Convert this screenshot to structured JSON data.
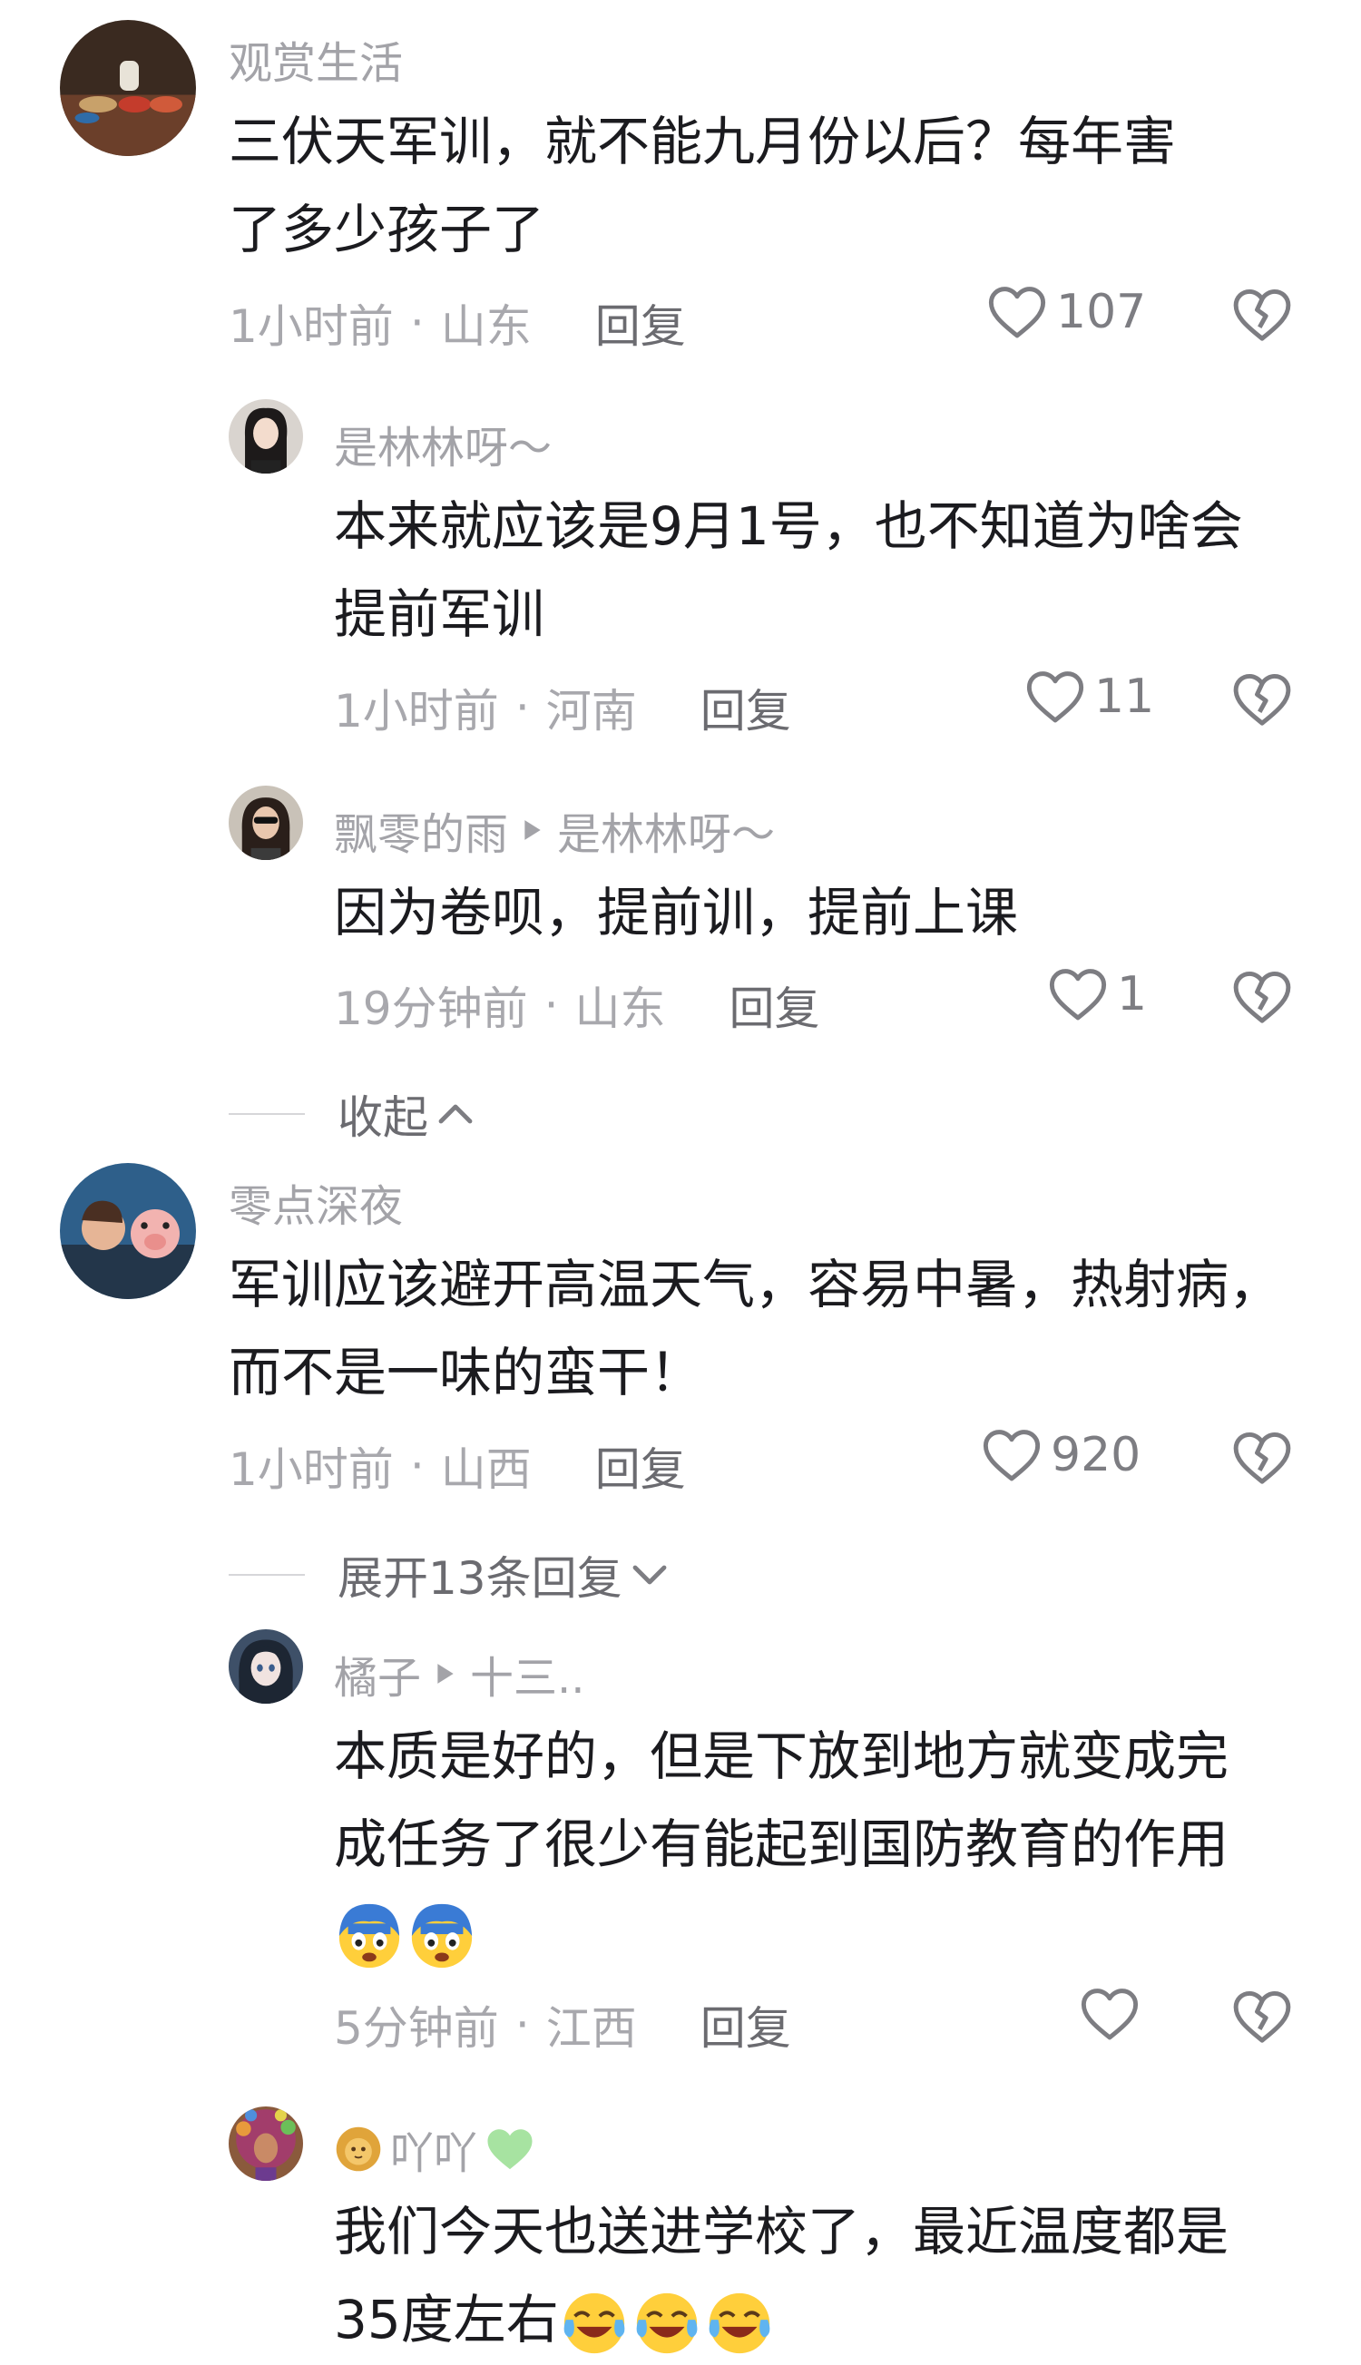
{
  "comments": [
    {
      "user": "观赏生活",
      "text_lines": [
        "三伏天军训，就不能九月份以后？每年害",
        "了多少孩子了"
      ],
      "time": "1小时前",
      "location": "山东",
      "reply_label": "回复",
      "likes": "107"
    },
    {
      "user": "是林林呀～",
      "text_lines": [
        "本来就应该是9月1号，也不知道为啥会",
        "提前军训"
      ],
      "time": "1小时前",
      "location": "河南",
      "reply_label": "回复",
      "likes": "11"
    },
    {
      "user": "飘零的雨",
      "reply_to": "是林林呀～",
      "text_lines": [
        "因为卷呗，提前训，提前上课"
      ],
      "time": "19分钟前",
      "location": "山东",
      "reply_label": "回复",
      "likes": "1"
    },
    {
      "user": "零点深夜",
      "text_lines": [
        "军训应该避开高温天气，容易中暑，热射病，",
        "而不是一味的蛮干！"
      ],
      "time": "1小时前",
      "location": "山西",
      "reply_label": "回复",
      "likes": "920"
    },
    {
      "user": "橘子",
      "reply_to": "十三..",
      "text_lines": [
        "本质是好的，但是下放到地方就变成完",
        "成任务了很少有能起到国防教育的作用"
      ],
      "emoji_line": [
        "scared-face-emoji",
        "scared-face-emoji"
      ],
      "time": "5分钟前",
      "location": "江西",
      "reply_label": "回复",
      "likes": ""
    },
    {
      "user": "吖吖",
      "user_prefix_icon": "lion-emoji",
      "user_suffix_icon": "green-heart-emoji",
      "text_lines": [
        "我们今天也送进学校了，最近温度都是"
      ],
      "last_line_text": "35度左右",
      "last_line_emojis": [
        "laugh-cry-emoji",
        "laugh-cry-emoji",
        "laugh-cry-emoji"
      ]
    }
  ],
  "fold_collapse": "收起",
  "fold_expand": "展开13条回复",
  "colors": {
    "name": "#a3a3a8",
    "text": "#1b1b1f",
    "meta": "#a8a8ad",
    "icon": "#7d7d82"
  }
}
